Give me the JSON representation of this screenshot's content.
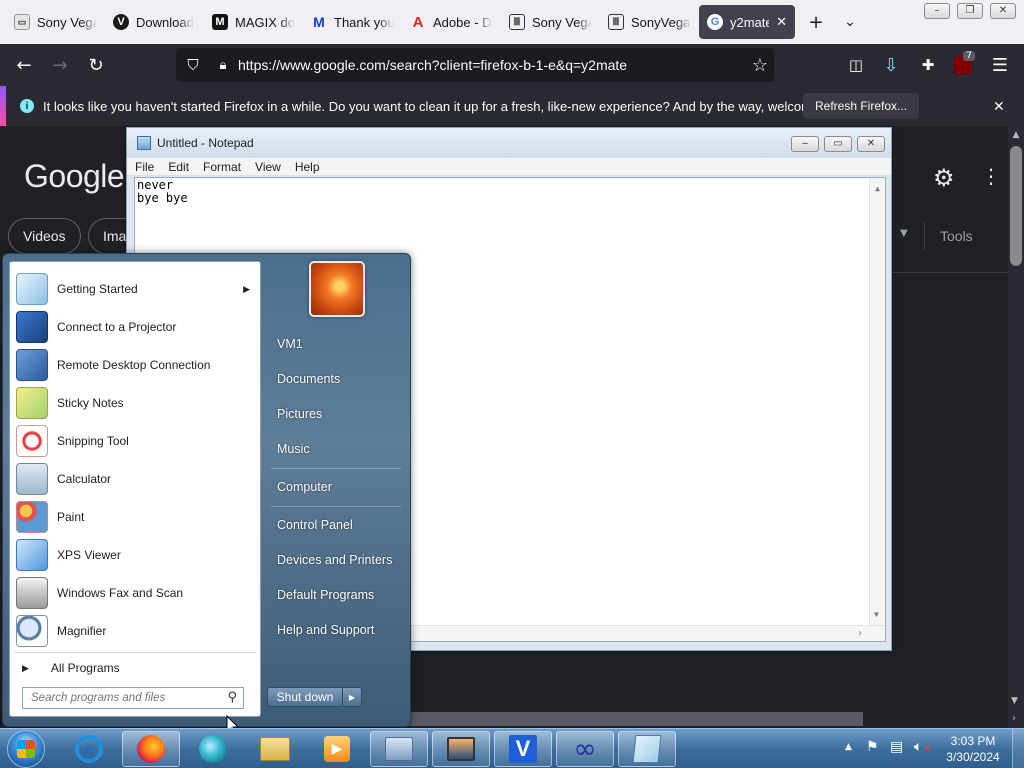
{
  "browser": {
    "tabs": [
      {
        "title": "Sony Vegas",
        "icon": "sony-favicon",
        "active": false
      },
      {
        "title": "Download",
        "icon": "vegas-favicon",
        "active": false
      },
      {
        "title": "MAGIX do",
        "icon": "magix-favicon",
        "active": false
      },
      {
        "title": "Thank you",
        "icon": "malwarebytes-favicon",
        "active": false
      },
      {
        "title": "Adobe - D",
        "icon": "adobe-favicon",
        "active": false
      },
      {
        "title": "Sony Vega",
        "icon": "archive-favicon",
        "active": false
      },
      {
        "title": "SonyVegas",
        "icon": "archive-favicon",
        "active": false
      },
      {
        "title": "y2mate",
        "icon": "google-favicon",
        "active": true
      }
    ],
    "new_tab": "+",
    "url": "https://www.google.com/search?client=firefox-b-1-e&q=y2mate",
    "extension_badge": "7",
    "notification": {
      "message": "It looks like you haven't started Firefox in a while. Do you want to clean it up for a fresh, like-new experience? And by the way, welcome back!",
      "button": "Refresh Firefox..."
    }
  },
  "google": {
    "logo": "Google",
    "chips": [
      "Videos",
      "Ima"
    ],
    "tools": "Tools"
  },
  "notepad": {
    "title": "Untitled - Notepad",
    "menu": [
      "File",
      "Edit",
      "Format",
      "View",
      "Help"
    ],
    "lines": [
      "never",
      "bye bye"
    ]
  },
  "start_menu": {
    "programs": [
      {
        "label": "Getting Started",
        "icon": "getting-started-icon",
        "submenu": true
      },
      {
        "label": "Connect to a Projector",
        "icon": "projector-icon",
        "submenu": false
      },
      {
        "label": "Remote Desktop Connection",
        "icon": "remote-desktop-icon",
        "submenu": false
      },
      {
        "label": "Sticky Notes",
        "icon": "sticky-notes-icon",
        "submenu": false
      },
      {
        "label": "Snipping Tool",
        "icon": "snipping-tool-icon",
        "submenu": false
      },
      {
        "label": "Calculator",
        "icon": "calculator-icon",
        "submenu": false
      },
      {
        "label": "Paint",
        "icon": "paint-icon",
        "submenu": false
      },
      {
        "label": "XPS Viewer",
        "icon": "xps-viewer-icon",
        "submenu": false
      },
      {
        "label": "Windows Fax and Scan",
        "icon": "fax-scan-icon",
        "submenu": false
      },
      {
        "label": "Magnifier",
        "icon": "magnifier-icon",
        "submenu": false
      }
    ],
    "all_programs": "All Programs",
    "search_placeholder": "Search programs and files",
    "right_items": [
      "VM1",
      "Documents",
      "Pictures",
      "Music",
      "Computer",
      "Control Panel",
      "Devices and Printers",
      "Default Programs",
      "Help and Support"
    ],
    "shutdown": "Shut down"
  },
  "taskbar": {
    "time": "3:03 PM",
    "date": "3/30/2024"
  },
  "colors": {
    "firefox_dark": "#2b2a33",
    "google_bg": "#202124",
    "taskbar": "#3f6f9e",
    "accent": "#0060df"
  }
}
